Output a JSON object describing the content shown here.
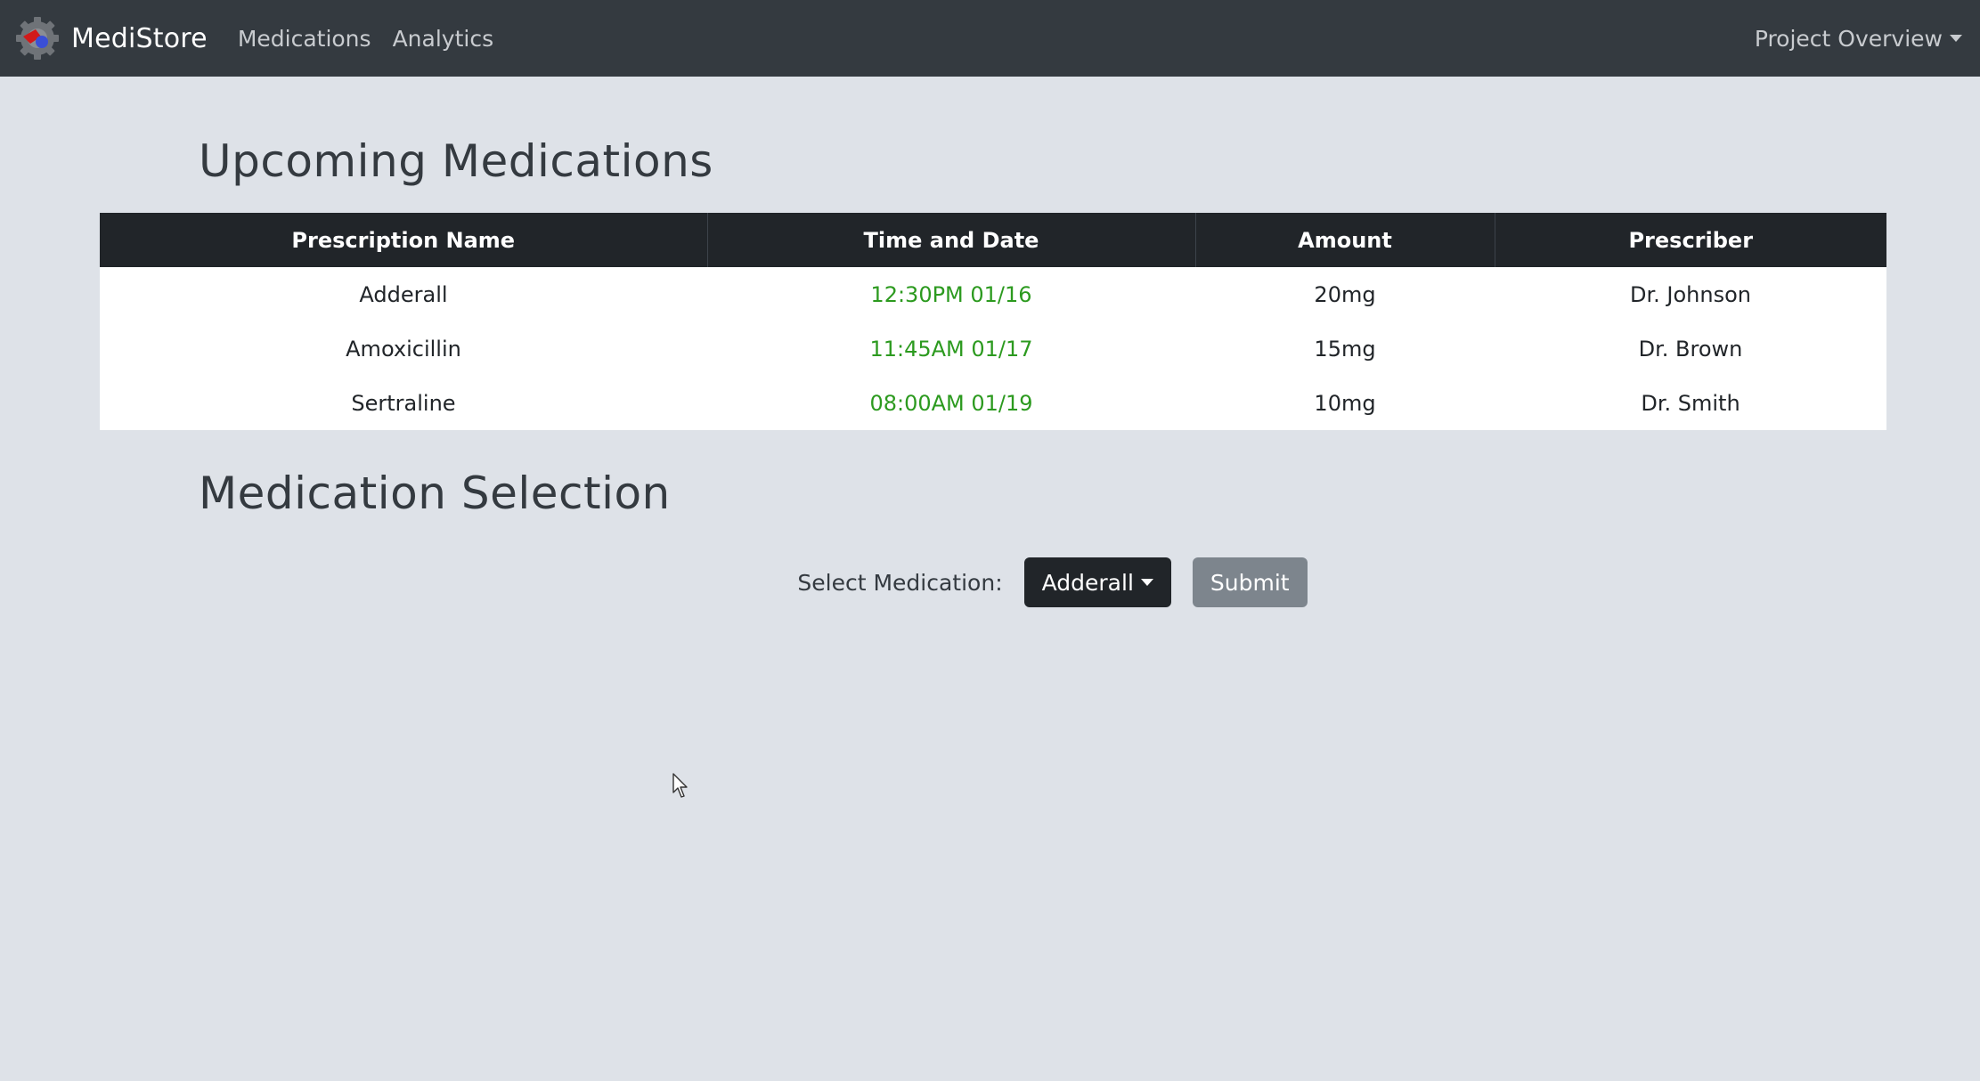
{
  "navbar": {
    "brand": "MediStore",
    "links": [
      "Medications",
      "Analytics"
    ],
    "right_menu": "Project Overview"
  },
  "upcoming": {
    "title": "Upcoming Medications",
    "columns": [
      "Prescription Name",
      "Time and Date",
      "Amount",
      "Prescriber"
    ],
    "rows": [
      {
        "name": "Adderall",
        "time": "12:30PM 01/16",
        "amount": "20mg",
        "prescriber": "Dr. Johnson"
      },
      {
        "name": "Amoxicillin",
        "time": "11:45AM 01/17",
        "amount": "15mg",
        "prescriber": "Dr. Brown"
      },
      {
        "name": "Sertraline",
        "time": "08:00AM 01/19",
        "amount": "10mg",
        "prescriber": "Dr. Smith"
      }
    ]
  },
  "selection": {
    "title": "Medication Selection",
    "label": "Select Medication:",
    "selected": "Adderall",
    "submit_label": "Submit"
  },
  "colors": {
    "navbar_bg": "#343a40",
    "page_bg": "#dee2e8",
    "time_text": "#2c9a1f",
    "dropdown_bg": "#212529",
    "submit_bg": "#7d858d"
  }
}
